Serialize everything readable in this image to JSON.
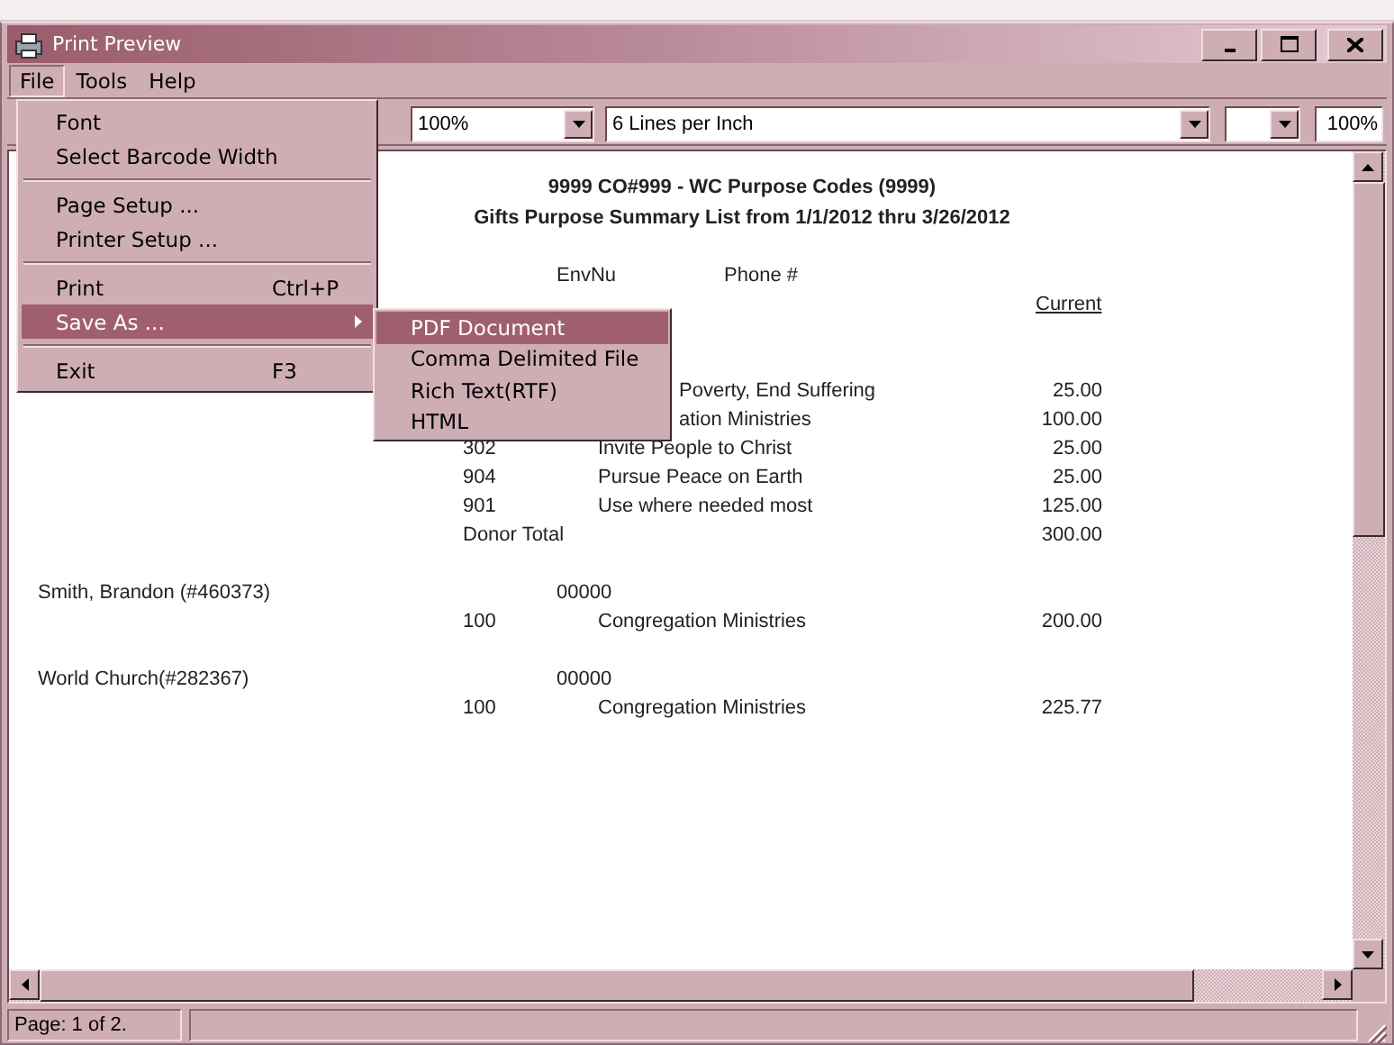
{
  "window": {
    "title": "Print Preview"
  },
  "menubar": [
    {
      "label": "File",
      "selected": true
    },
    {
      "label": "Tools",
      "selected": false
    },
    {
      "label": "Help",
      "selected": false
    }
  ],
  "file_menu": [
    {
      "kind": "item",
      "label": "Font",
      "highlighted": false
    },
    {
      "kind": "item",
      "label": "Select Barcode Width",
      "highlighted": false
    },
    {
      "kind": "separator"
    },
    {
      "kind": "item",
      "label": "Page Setup ...",
      "highlighted": false
    },
    {
      "kind": "item",
      "label": "Printer Setup ...",
      "highlighted": false
    },
    {
      "kind": "separator"
    },
    {
      "kind": "item",
      "label": "Print",
      "shortcut": "Ctrl+P",
      "highlighted": false
    },
    {
      "kind": "submenu",
      "label": "Save As ...",
      "highlighted": true
    },
    {
      "kind": "separator"
    },
    {
      "kind": "item",
      "label": "Exit",
      "shortcut": "F3",
      "highlighted": false
    }
  ],
  "save_as_submenu": [
    {
      "label": "PDF Document",
      "highlighted": true
    },
    {
      "label": "Comma Delimited File",
      "highlighted": false
    },
    {
      "label": "Rich Text(RTF)",
      "highlighted": false
    },
    {
      "label": "HTML",
      "highlighted": false
    }
  ],
  "toolbar": {
    "zoom": "100%",
    "line_spacing": "6 Lines per Inch",
    "zoom_readout": "100%"
  },
  "report": {
    "title": "9999 CO#999 - WC Purpose Codes (9999)",
    "subtitle": "Gifts Purpose Summary List from 1/1/2012 thru 3/26/2012",
    "column_headers": [
      "EnvNu",
      "Phone #",
      "Current"
    ],
    "rows": [
      {
        "kind": "partial",
        "code": "",
        "description": "Poverty, End Suffering",
        "amount": "25.00"
      },
      {
        "kind": "partial",
        "code": "",
        "description": "ation Ministries",
        "amount": "100.00"
      },
      {
        "kind": "line",
        "code": "302",
        "description": "Invite People to Christ",
        "amount": "25.00"
      },
      {
        "kind": "line",
        "code": "904",
        "description": "Pursue Peace on Earth",
        "amount": "25.00"
      },
      {
        "kind": "line",
        "code": "901",
        "description": "Use where needed most",
        "amount": "125.00"
      },
      {
        "kind": "total",
        "label": "Donor Total",
        "amount": "300.00"
      },
      {
        "kind": "donor",
        "name": "Smith, Brandon (#460373)",
        "envelope": "00000"
      },
      {
        "kind": "line",
        "code": "100",
        "description": "Congregation Ministries",
        "amount": "200.00"
      },
      {
        "kind": "donor",
        "name": "World Church(#282367)",
        "envelope": "00000"
      },
      {
        "kind": "line",
        "code": "100",
        "description": "Congregation Ministries",
        "amount": "225.77"
      }
    ]
  },
  "status_bar": {
    "page": "Page: 1 of 2."
  }
}
